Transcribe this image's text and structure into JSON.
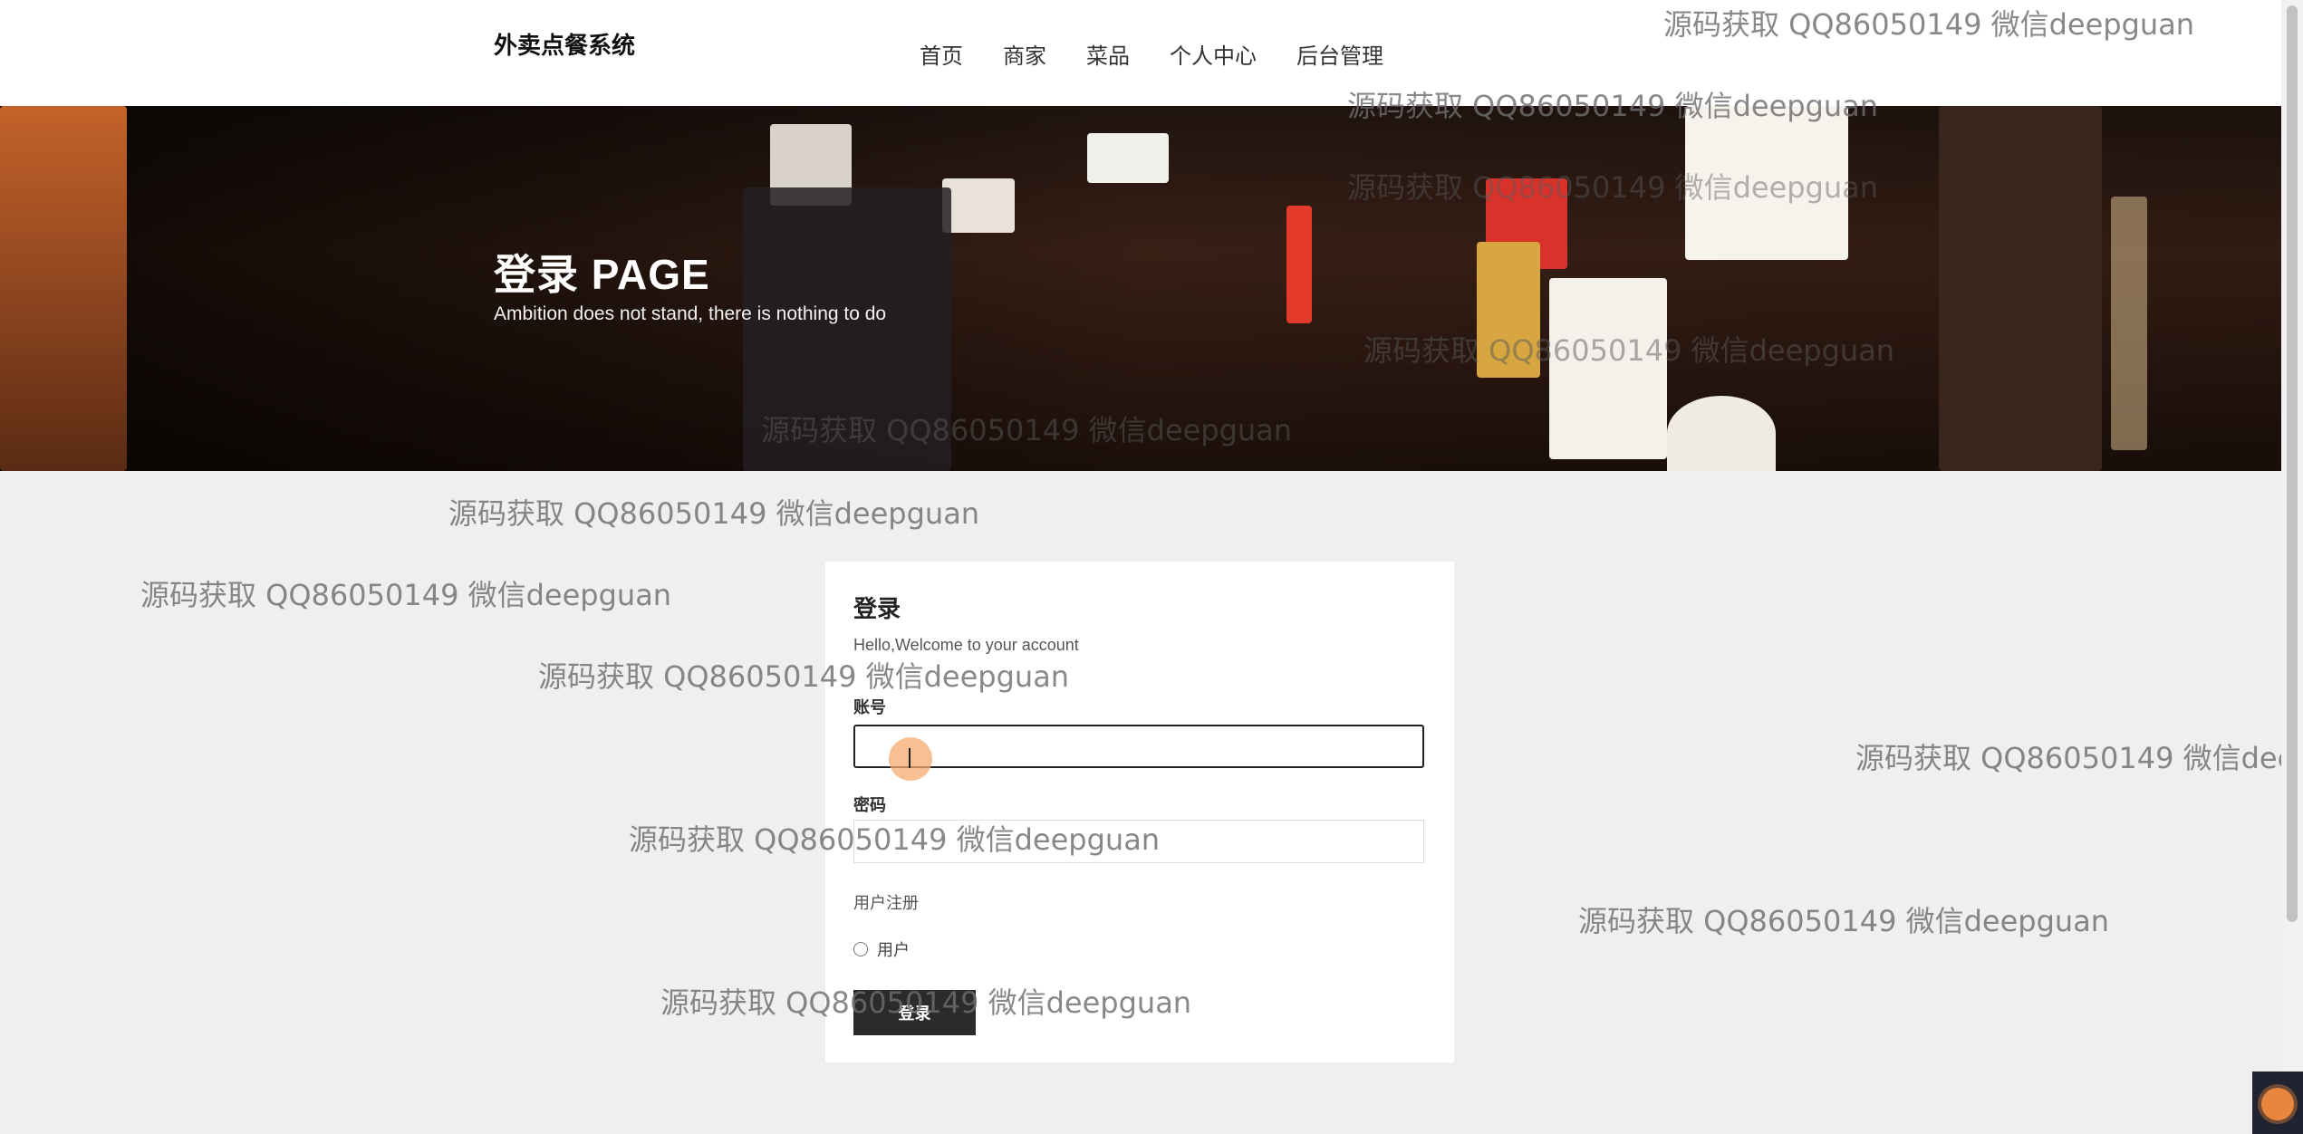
{
  "header": {
    "brand": "外卖点餐系统",
    "nav": [
      "首页",
      "商家",
      "菜品",
      "个人中心",
      "后台管理"
    ]
  },
  "hero": {
    "title": "登录 PAGE",
    "subtitle": "Ambition does not stand, there is nothing to do"
  },
  "login_card": {
    "title": "登录",
    "subtitle": "Hello,Welcome to your account",
    "account_label": "账号",
    "account_value": "",
    "password_label": "密码",
    "password_value": "",
    "register_label": "用户注册",
    "role_option": "用户",
    "submit_label": "登录"
  },
  "watermark": "源码获取 QQ86050149 微信deepguan",
  "colors": {
    "button": "#2b2b2b",
    "page_bg": "#efefef",
    "cursor_highlight": "#f5aa6e"
  }
}
